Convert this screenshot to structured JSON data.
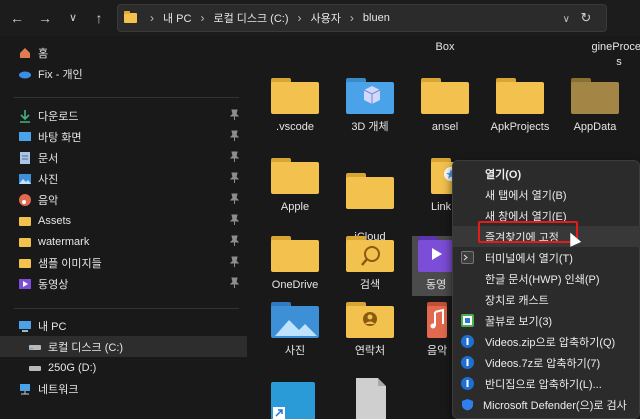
{
  "toolbar": {
    "back_icon": "←",
    "forward_icon": "→",
    "down_icon": "∨",
    "up_icon": "↑",
    "breadcrumb": [
      "내 PC",
      "로컬 디스크 (C:)",
      "사용자",
      "bluen"
    ],
    "expand_icon": "›",
    "dropdown_icon": "∨",
    "refresh_icon": "↻"
  },
  "sidebar": {
    "pin_icon": "📌",
    "items": [
      {
        "label": "홈",
        "icon": "home-icon"
      },
      {
        "label": "Fix - 개인",
        "icon": "onedrive-icon"
      },
      {
        "label": "다운로드",
        "icon": "download-icon",
        "pinned": true
      },
      {
        "label": "바탕 화면",
        "icon": "desktop-icon",
        "pinned": true
      },
      {
        "label": "문서",
        "icon": "documents-icon",
        "pinned": true
      },
      {
        "label": "사진",
        "icon": "pictures-icon",
        "pinned": true
      },
      {
        "label": "음악",
        "icon": "music-icon",
        "pinned": true
      },
      {
        "label": "Assets",
        "icon": "folder-icon",
        "pinned": true
      },
      {
        "label": "watermark",
        "icon": "folder-icon",
        "pinned": true
      },
      {
        "label": "샘플 이미지들",
        "icon": "folder-icon",
        "pinned": true
      },
      {
        "label": "동영상",
        "icon": "videos-icon",
        "pinned": true
      },
      {
        "label": "내 PC",
        "icon": "pc-icon"
      },
      {
        "label": "로컬 디스크 (C:)",
        "icon": "drive-icon",
        "selected": true
      },
      {
        "label": "250G (D:)",
        "icon": "drive-icon"
      },
      {
        "label": "네트워크",
        "icon": "network-icon"
      }
    ]
  },
  "content": {
    "top_partial": [
      "Box",
      "gineProces\ns"
    ],
    "tiles": [
      {
        "label": ".vscode",
        "icon": "folder-icon"
      },
      {
        "label": "3D 개체",
        "icon": "3d-objects-icon"
      },
      {
        "label": "ansel",
        "icon": "folder-icon"
      },
      {
        "label": "ApkProjects",
        "icon": "folder-icon"
      },
      {
        "label": "AppData",
        "icon": "folder-icon"
      },
      {
        "label": "Apple",
        "icon": "folder-icon"
      },
      {
        "label": "iCloud\nDrive",
        "icon": "folder-icon"
      },
      {
        "label": "Link",
        "icon": "folder-icon"
      },
      {
        "label": "OneDrive",
        "icon": "folder-icon"
      },
      {
        "label": "검색",
        "icon": "search-folder-icon"
      },
      {
        "label": "동영",
        "icon": "videos-folder-icon"
      },
      {
        "label": "사진",
        "icon": "pictures-folder-icon"
      },
      {
        "label": "연락처",
        "icon": "contacts-folder-icon"
      },
      {
        "label": "음악",
        "icon": "music-folder-icon"
      }
    ]
  },
  "context_menu": {
    "items": [
      {
        "label": "열기(O)",
        "bold": true
      },
      {
        "label": "새 탭에서 열기(B)"
      },
      {
        "label": "새 창에서 열기(E)"
      },
      {
        "label": "즐겨찾기에 고정",
        "highlighted": true
      },
      {
        "label": "터미널에서 열기(T)",
        "icon": "terminal-icon"
      },
      {
        "label": "한글 문서(HWP) 인쇄(P)"
      },
      {
        "label": "장치로 캐스트"
      },
      {
        "label": "꿀뷰로 보기(3)",
        "icon": "honeyview-icon"
      },
      {
        "label": "Videos.zip으로 압축하기(Q)",
        "icon": "bandizip-icon"
      },
      {
        "label": "Videos.7z로 압축하기(7)",
        "icon": "bandizip-icon"
      },
      {
        "label": "반디집으로 압축하기(L)...",
        "icon": "bandizip-icon"
      },
      {
        "label": "Microsoft Defender(으)로 검사",
        "icon": "defender-icon"
      }
    ]
  }
}
